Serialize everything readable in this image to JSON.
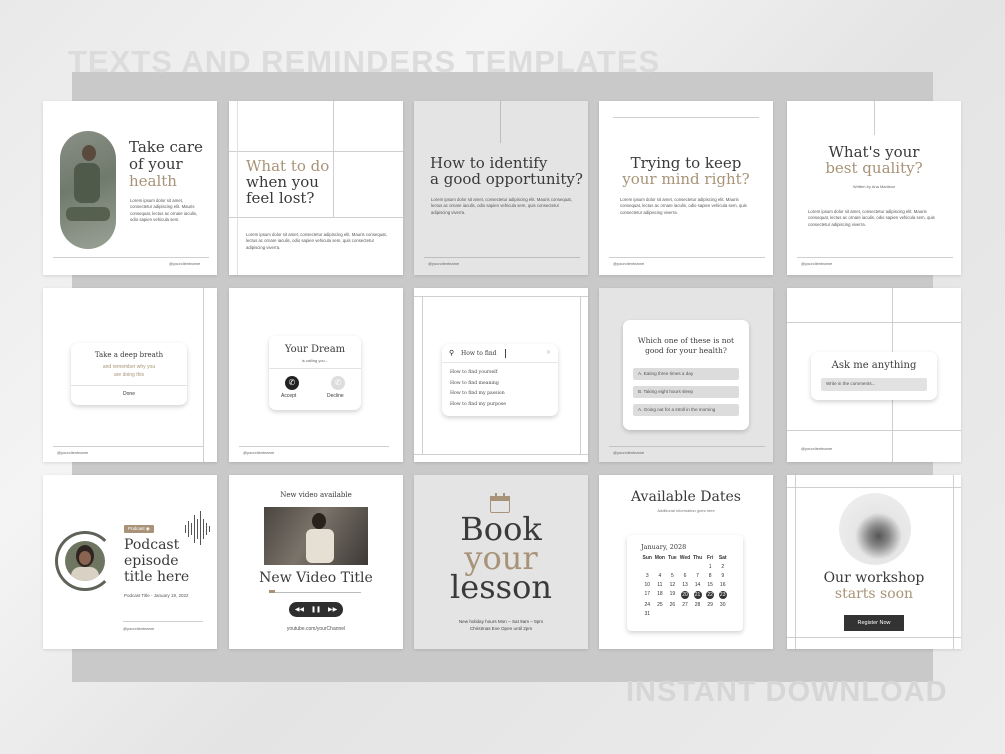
{
  "header_title": "TEXTS AND REMINDERS TEMPLATES",
  "footer_title": "INSTANT DOWNLOAD",
  "handle": "@yourclientname",
  "colors": {
    "accent_tan": "#a89378",
    "dark": "#333333",
    "backdrop": "#c9c9c9"
  },
  "lorem_short": "Lorem ipsum dolor sit amet, consectetur adipiscing elit. Mauris consequat, lectus ac ornare iaculis, odio sapien vehicula sem, quis consectetur adipiscing viverra.",
  "c1": {
    "title_1": "Take care",
    "title_2": "of your",
    "title_3": "health",
    "body": "Lorem ipsum dolor sit amet, consectetur adipiscing elit. Mauris consequat, lectus ac ornare iaculis, odio sapien vehicula sem."
  },
  "c2": {
    "title_1": "What to do",
    "title_2": "when you",
    "title_3": "feel lost?"
  },
  "c3": {
    "title_1": "How to identify",
    "title_2": "a good opportunity?"
  },
  "c4": {
    "title_1": "Trying to keep",
    "title_2": "your mind right?"
  },
  "c5": {
    "title_1": "What's your",
    "title_2": "best quality?",
    "byline": "Written by Ana Madison"
  },
  "c6": {
    "title": "Take a deep breath",
    "sub_1": "and remember why you",
    "sub_2": "are doing this",
    "button": "Done"
  },
  "c7": {
    "title": "Your Dream",
    "sub": "is calling you...",
    "accept": "Accept",
    "decline": "Decline"
  },
  "c8": {
    "search": "How to find",
    "results": [
      "How to find yourself",
      "How to find meaning",
      "How to find my passion",
      "How to find my purpose"
    ]
  },
  "c9": {
    "question_1": "Which one of these is not",
    "question_2": "good for your health?",
    "options": [
      "A. Eating three times a day",
      "B. Taking eight hours sleep",
      "A. Going out for a stroll in the morning"
    ]
  },
  "c10": {
    "title": "Ask me anything",
    "placeholder": "Write in the comments..."
  },
  "c11": {
    "badge": "Podcast",
    "title_1": "Podcast",
    "title_2": "episode",
    "title_3": "title here",
    "meta": "Podcast Title - January 19, 2022"
  },
  "c12": {
    "top": "New video available",
    "title": "New Video Title",
    "url": "youtube.com/yourChannel"
  },
  "c13": {
    "w1": "Book",
    "w2": "your",
    "w3": "lesson",
    "hours_1": "New holiday hours Mon – Sat 9am – 9pm",
    "hours_2": "Christmas Eve Open until 2pm"
  },
  "c14": {
    "title": "Available Dates",
    "sub": "Additional information goes here",
    "month": "January, 2028",
    "days": [
      "Sun",
      "Mon",
      "Tue",
      "Wed",
      "Thu",
      "Fri",
      "Sat"
    ],
    "dates": [
      "",
      "",
      "",
      "",
      "",
      "1",
      "2",
      "3",
      "4",
      "5",
      "6",
      "7",
      "8",
      "9",
      "10",
      "11",
      "12",
      "13",
      "14",
      "15",
      "16",
      "17",
      "18",
      "19",
      "20",
      "21",
      "22",
      "23",
      "24",
      "25",
      "26",
      "27",
      "28",
      "29",
      "30",
      "31"
    ],
    "highlighted": [
      "20",
      "21",
      "22",
      "23"
    ]
  },
  "c15": {
    "title_1": "Our workshop",
    "title_2": "starts soon",
    "button": "Register Now"
  }
}
